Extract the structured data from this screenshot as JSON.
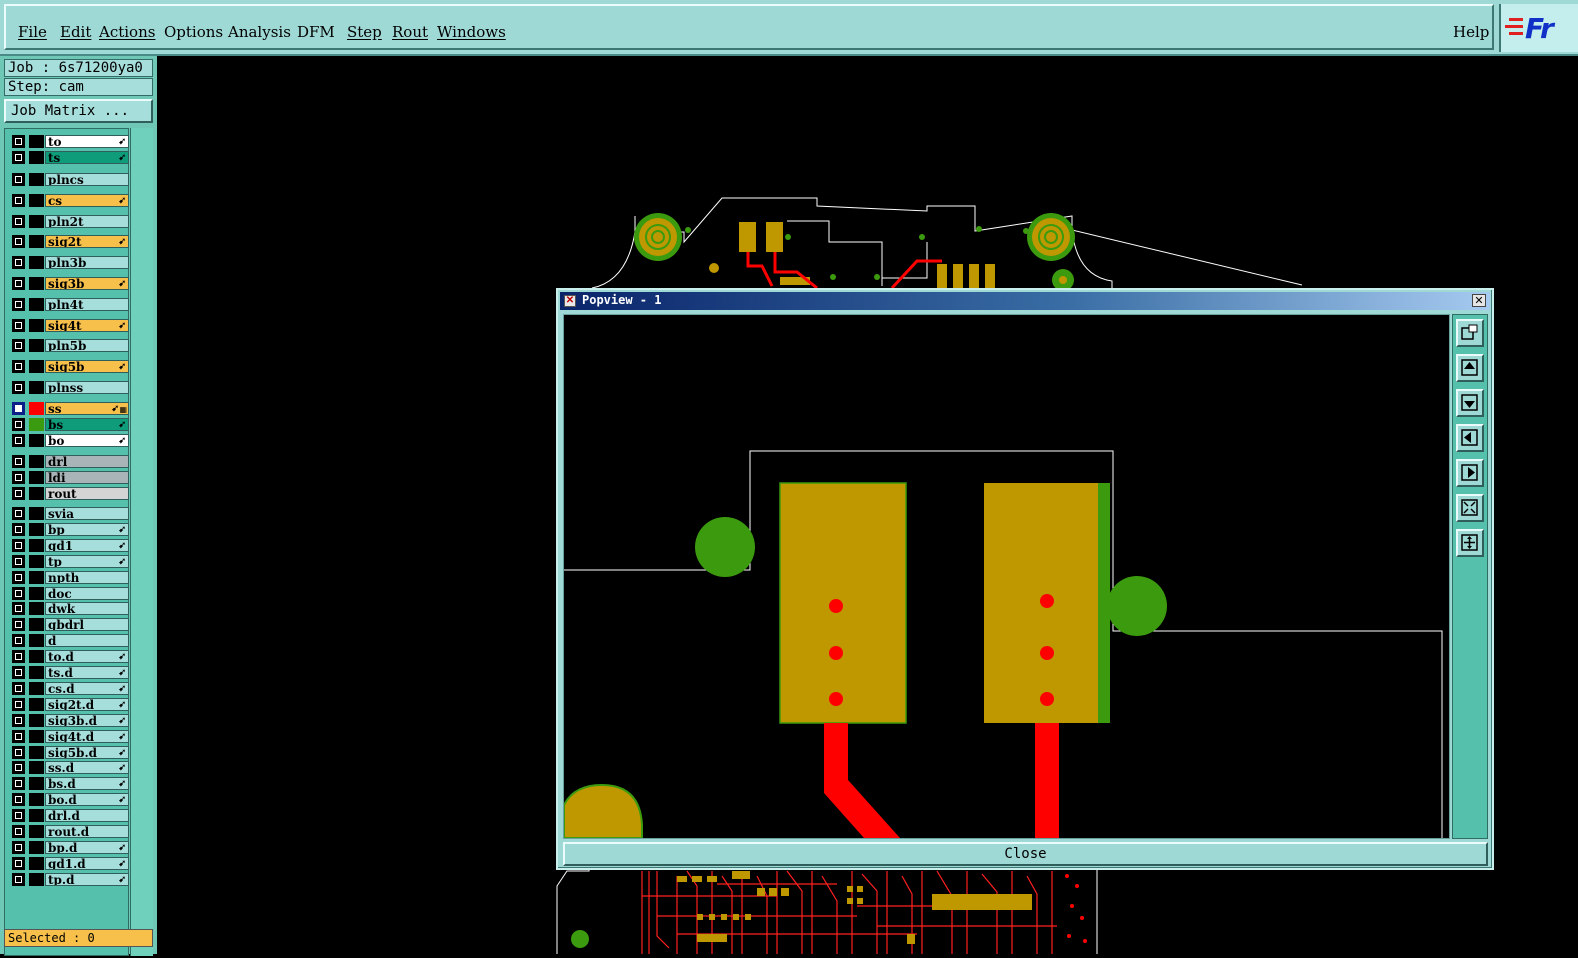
{
  "menu": {
    "items": [
      "File",
      "Edit",
      "Actions",
      "Options",
      "Analysis",
      "DFM",
      "Step",
      "Rout",
      "Windows"
    ],
    "help": "Help",
    "logo_text": "Fr"
  },
  "job": {
    "job_label": "Job : 6s71200ya0",
    "step_label": "Step: cam",
    "matrix_button": "Job Matrix ..."
  },
  "layers": [
    {
      "name": "to",
      "color": "#ffffff",
      "flag": true,
      "swatch": "#000000",
      "active": false
    },
    {
      "name": "ts",
      "color": "#0f9c7a",
      "flag": true,
      "swatch": "#000000",
      "active": false
    },
    {
      "name": "plncs",
      "color": "#a6dedb",
      "flag": false,
      "swatch": "#000000",
      "active": false
    },
    {
      "name": "cs",
      "color": "#f7c04a",
      "flag": true,
      "swatch": "#000000",
      "active": false
    },
    {
      "name": "pln2t",
      "color": "#a6dedb",
      "flag": false,
      "swatch": "#000000",
      "active": false
    },
    {
      "name": "sig2t",
      "color": "#f7c04a",
      "flag": true,
      "swatch": "#000000",
      "active": false
    },
    {
      "name": "pln3b",
      "color": "#a6dedb",
      "flag": false,
      "swatch": "#000000",
      "active": false
    },
    {
      "name": "sig3b",
      "color": "#f7c04a",
      "flag": true,
      "swatch": "#000000",
      "active": false
    },
    {
      "name": "pln4t",
      "color": "#a6dedb",
      "flag": false,
      "swatch": "#000000",
      "active": false
    },
    {
      "name": "sig4t",
      "color": "#f7c04a",
      "flag": true,
      "swatch": "#000000",
      "active": false
    },
    {
      "name": "pln5b",
      "color": "#a6dedb",
      "flag": false,
      "swatch": "#000000",
      "active": false
    },
    {
      "name": "sig5b",
      "color": "#f7c04a",
      "flag": true,
      "swatch": "#000000",
      "active": false
    },
    {
      "name": "plnss",
      "color": "#a6dedb",
      "flag": false,
      "swatch": "#000000",
      "active": false
    },
    {
      "name": "ss",
      "color": "#f7c04a",
      "flag": true,
      "swatch": "#ff0000",
      "active": true
    },
    {
      "name": "bs",
      "color": "#0f9c7a",
      "flag": true,
      "swatch": "#3a9a10",
      "active": false
    },
    {
      "name": "bo",
      "color": "#ffffff",
      "flag": true,
      "swatch": "#000000",
      "active": false
    },
    {
      "name": "drl",
      "color": "#a8b4b8",
      "flag": false,
      "swatch": "#000000",
      "active": false
    },
    {
      "name": "ldi",
      "color": "#a8b4b8",
      "flag": false,
      "swatch": "#000000",
      "active": false
    },
    {
      "name": "rout",
      "color": "#d4d4d4",
      "flag": false,
      "swatch": "#000000",
      "active": false
    },
    {
      "name": "svia",
      "color": "#a6dedb",
      "flag": false,
      "swatch": "#000000",
      "active": false
    },
    {
      "name": "bp",
      "color": "#a6dedb",
      "flag": true,
      "swatch": "#000000",
      "active": false
    },
    {
      "name": "gd1",
      "color": "#a6dedb",
      "flag": true,
      "swatch": "#000000",
      "active": false
    },
    {
      "name": "tp",
      "color": "#a6dedb",
      "flag": true,
      "swatch": "#000000",
      "active": false
    },
    {
      "name": "npth",
      "color": "#a6dedb",
      "flag": false,
      "swatch": "#000000",
      "active": false
    },
    {
      "name": "doc",
      "color": "#a6dedb",
      "flag": false,
      "swatch": "#000000",
      "active": false
    },
    {
      "name": "dwk",
      "color": "#a6dedb",
      "flag": false,
      "swatch": "#000000",
      "active": false
    },
    {
      "name": "gbdrl",
      "color": "#a6dedb",
      "flag": false,
      "swatch": "#000000",
      "active": false
    },
    {
      "name": "d",
      "color": "#a6dedb",
      "flag": false,
      "swatch": "#000000",
      "active": false
    },
    {
      "name": "to.d",
      "color": "#a6dedb",
      "flag": true,
      "swatch": "#000000",
      "active": false
    },
    {
      "name": "ts.d",
      "color": "#a6dedb",
      "flag": true,
      "swatch": "#000000",
      "active": false
    },
    {
      "name": "cs.d",
      "color": "#a6dedb",
      "flag": true,
      "swatch": "#000000",
      "active": false
    },
    {
      "name": "sig2t.d",
      "color": "#a6dedb",
      "flag": true,
      "swatch": "#000000",
      "active": false
    },
    {
      "name": "sig3b.d",
      "color": "#a6dedb",
      "flag": true,
      "swatch": "#000000",
      "active": false
    },
    {
      "name": "sig4t.d",
      "color": "#a6dedb",
      "flag": true,
      "swatch": "#000000",
      "active": false
    },
    {
      "name": "sig5b.d",
      "color": "#a6dedb",
      "flag": true,
      "swatch": "#000000",
      "active": false
    },
    {
      "name": "ss.d",
      "color": "#a6dedb",
      "flag": true,
      "swatch": "#000000",
      "active": false
    },
    {
      "name": "bs.d",
      "color": "#a6dedb",
      "flag": true,
      "swatch": "#000000",
      "active": false
    },
    {
      "name": "bo.d",
      "color": "#a6dedb",
      "flag": true,
      "swatch": "#000000",
      "active": false
    },
    {
      "name": "drl.d",
      "color": "#a6dedb",
      "flag": false,
      "swatch": "#000000",
      "active": false
    },
    {
      "name": "rout.d",
      "color": "#a6dedb",
      "flag": false,
      "swatch": "#000000",
      "active": false
    },
    {
      "name": "bp.d",
      "color": "#a6dedb",
      "flag": true,
      "swatch": "#000000",
      "active": false
    },
    {
      "name": "gd1.d",
      "color": "#a6dedb",
      "flag": true,
      "swatch": "#000000",
      "active": false
    },
    {
      "name": "tp.d",
      "color": "#a6dedb",
      "flag": true,
      "swatch": "#000000",
      "active": false
    }
  ],
  "status": {
    "selected": "Selected : 0"
  },
  "popview": {
    "title": "Popview - 1",
    "close_button": "Close",
    "tools": [
      "zoom-window-icon",
      "pan-up-icon",
      "pan-down-icon",
      "pan-left-icon",
      "pan-right-icon",
      "zoom-fit-icon",
      "zoom-home-icon"
    ]
  },
  "colors": {
    "copper": "#bf9800",
    "soldermask": "#3b9a0e",
    "trace": "#ff0000",
    "outline": "#ffffff",
    "menu_bg": "#9fd9d6",
    "panel_bg": "#6fc8b6"
  }
}
